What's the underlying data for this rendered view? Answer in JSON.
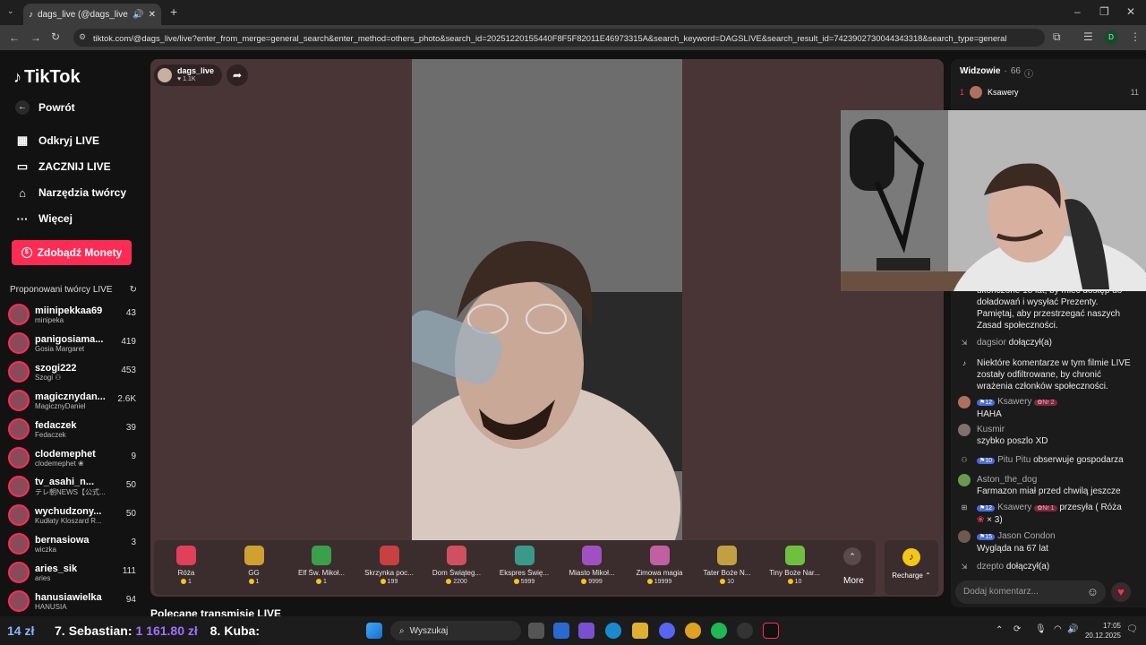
{
  "browser": {
    "tab_title": "dags_live (@dags_live) pro...",
    "url": "tiktok.com/@dags_live/live?enter_from_merge=general_search&enter_method=others_photo&search_id=20251220155440F8F5F82011E46973315A&search_keyword=DAGSLIVE&search_result_id=7423902730044343318&search_type=general",
    "profile_initial": "D"
  },
  "sidebar": {
    "logo": "TikTok",
    "back": "Powrót",
    "nav": [
      {
        "label": "Odkryj LIVE",
        "icon": "calendar-live-icon"
      },
      {
        "label": "ZACZNIJ LIVE",
        "icon": "camera-icon"
      },
      {
        "label": "Narzędzia twórcy",
        "icon": "house-icon"
      },
      {
        "label": "Więcej",
        "icon": "more-icon"
      }
    ],
    "coins_button": "Zdobądź Monety",
    "section_title": "Proponowani twórcy LIVE",
    "creators": [
      {
        "name": "miinipekkaa69",
        "sub": "minipeka",
        "count": "43"
      },
      {
        "name": "panigosiama...",
        "sub": "Gosia Margaret",
        "count": "419"
      },
      {
        "name": "szogi222",
        "sub": "Szogi ⚇",
        "count": "453"
      },
      {
        "name": "magicznydan...",
        "sub": "MagicznyDaniel",
        "count": "2.6K"
      },
      {
        "name": "fedaczek",
        "sub": "Fedaczek",
        "count": "39"
      },
      {
        "name": "clodemephet",
        "sub": "clodemephet ❀",
        "count": "9"
      },
      {
        "name": "tv_asahi_n...",
        "sub": "テレ朝NEWS【公式...",
        "count": "50"
      },
      {
        "name": "wychudzony...",
        "sub": "Kudłaty Kloszard R...",
        "count": "50"
      },
      {
        "name": "bernasiowa",
        "sub": "wiczka",
        "count": "3"
      },
      {
        "name": "aries_sik",
        "sub": "aries",
        "count": "111"
      },
      {
        "name": "hanusiawielka",
        "sub": "HANUSIA",
        "count": "94"
      }
    ]
  },
  "stream": {
    "host": "dags_live",
    "likes": "1.1K",
    "recommended_title": "Polecane transmisje LIVE"
  },
  "gifts": [
    {
      "name": "Róża",
      "price": "1",
      "color": "#e0405a"
    },
    {
      "name": "GG",
      "price": "1",
      "color": "#d0a030"
    },
    {
      "name": "Elf Św. Mikoł...",
      "price": "1",
      "color": "#3aa04a"
    },
    {
      "name": "Skrzynka poc...",
      "price": "199",
      "color": "#c84040"
    },
    {
      "name": "Dom Świąteg...",
      "price": "2200",
      "color": "#d05060"
    },
    {
      "name": "Ekspres Świę...",
      "price": "5999",
      "color": "#3a9a8a"
    },
    {
      "name": "Miasto Mikoł...",
      "price": "9999",
      "color": "#a050c0"
    },
    {
      "name": "Zimowa magia",
      "price": "19999",
      "color": "#c060a0"
    },
    {
      "name": "Tater Boże N...",
      "price": "10",
      "color": "#c0a040"
    },
    {
      "name": "Tiny Boże Nar...",
      "price": "10",
      "color": "#70c040"
    }
  ],
  "gift_more": "More",
  "recharge": "Recharge",
  "chat": {
    "viewers_label": "Widzowie",
    "viewers_count": "66",
    "top_viewer": {
      "rank": "1",
      "name": "Ksawery",
      "score": "11"
    },
    "notice1": "ukończone 18 lat, by mieć dostęp do doładowań i wysyłać Prezenty. Pamiętaj, aby przestrzegać naszych Zasad społeczności.",
    "join1_user": "dagsior",
    "join_text": "dołączył(a)",
    "notice2": "Niektóre komentarze w tym filmie LIVE zostały odfiltrowane, by chronić wrażenia członków społeczności.",
    "m1_level": "12",
    "m1_user": "Ksawery",
    "m1_fan": "Nr 2",
    "m1_text": "HAHA",
    "m2_user": "Kusmir",
    "m2_text": "szybko poszlo XD",
    "m3_level": "10",
    "m3_user": "Pitu Pitu",
    "m3_text": "obserwuje gospodarza",
    "m4_user": "Aston_the_dog",
    "m4_text": "Farmazon miał przed chwilą jeszcze",
    "m5_level": "12",
    "m5_user": "Ksawery",
    "m5_fan": "Nr 1",
    "m5_text": "przesyła ( Róża",
    "m5_text2": "× 3)",
    "m6_level": "15",
    "m6_user": "Jason Condon",
    "m6_text": "Wygląda na 67 lat",
    "join2_user": "dzepto",
    "input_placeholder": "Dodaj komentarz..."
  },
  "ticker": {
    "left": "14 zł",
    "entry1_rank": "7.",
    "entry1_name": "Sebastian:",
    "entry1_amount": "1 161.80 zł",
    "entry2_rank": "8.",
    "entry2_name": "Kuba:"
  },
  "taskbar": {
    "search": "Wyszukaj",
    "time": "17:05",
    "date": "20.12.2025"
  }
}
